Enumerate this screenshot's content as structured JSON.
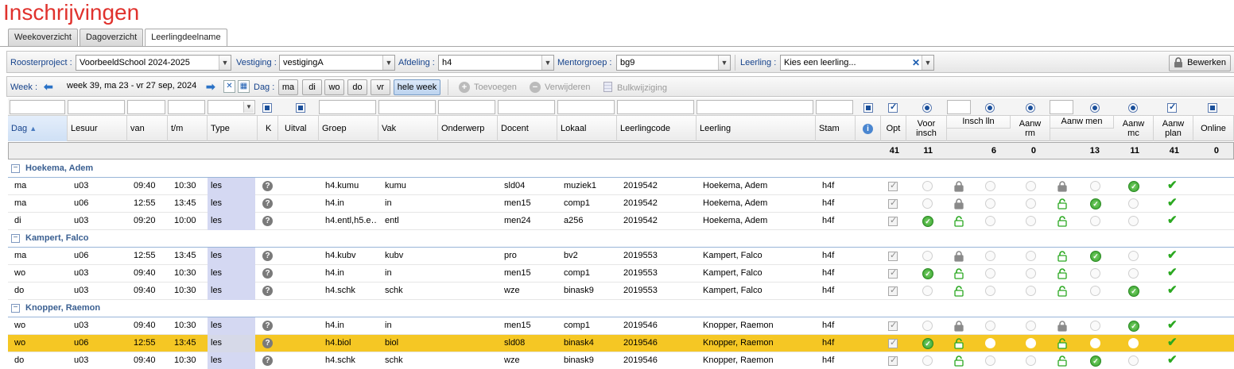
{
  "title": "Inschrijvingen",
  "tabs": [
    "Weekoverzicht",
    "Dagoverzicht",
    "Leerlingdeelname"
  ],
  "filters": {
    "roosterproject_label": "Roosterproject :",
    "roosterproject_value": "VoorbeeldSchool 2024-2025",
    "vestiging_label": "Vestiging :",
    "vestiging_value": "vestigingA",
    "afdeling_label": "Afdeling :",
    "afdeling_value": "h4",
    "mentorgroep_label": "Mentorgroep :",
    "mentorgroep_value": "bg9",
    "leerling_label": "Leerling :",
    "leerling_placeholder": "Kies een leerling...",
    "edit_button": "Bewerken"
  },
  "weekbar": {
    "week_label": "Week :",
    "week_value": "week 39, ma 23 - vr 27 sep, 2024",
    "dag_label": "Dag :",
    "days": [
      "ma",
      "di",
      "wo",
      "do",
      "vr"
    ],
    "all_week": "hele week",
    "toevoegen": "Toevoegen",
    "verwijderen": "Verwijderen",
    "bulkwijziging": "Bulkwijziging"
  },
  "columns": {
    "dag": "Dag",
    "lesuur": "Lesuur",
    "van": "van",
    "tm": "t/m",
    "type": "Type",
    "k": "K",
    "uitval": "Uitval",
    "groep": "Groep",
    "vak": "Vak",
    "onderwerp": "Onderwerp",
    "docent": "Docent",
    "lokaal": "Lokaal",
    "leerlingcode": "Leerlingcode",
    "leerling": "Leerling",
    "stam": "Stam",
    "opt": "Opt",
    "voor_insch_1": "Voor",
    "voor_insch_2": "insch",
    "insch_lln": "Insch lln",
    "aanw_rm_1": "Aanw",
    "aanw_rm_2": "rm",
    "aanw_men": "Aanw men",
    "aanw_mc_1": "Aanw",
    "aanw_mc_2": "mc",
    "aanw_plan_1": "Aanw",
    "aanw_plan_2": "plan",
    "online": "Online"
  },
  "totals": {
    "opt": "41",
    "voor_insch": "11",
    "insch_lln": "6",
    "aanw_rm": "0",
    "aanw_men": "13",
    "aanw_mc": "11",
    "aanw_plan": "41",
    "online": "0"
  },
  "groups": [
    {
      "name": "Hoekema, Adem",
      "rows": [
        {
          "dag": "ma",
          "lesuur": "u03",
          "van": "09:40",
          "tm": "10:30",
          "type": "les",
          "groep": "h4.kumu",
          "vak": "kumu",
          "docent": "sld04",
          "lokaal": "muziek1",
          "code": "2019542",
          "leerling": "Hoekema, Adem",
          "stam": "h4f"
        },
        {
          "dag": "ma",
          "lesuur": "u06",
          "van": "12:55",
          "tm": "13:45",
          "type": "les",
          "groep": "h4.in",
          "vak": "in",
          "docent": "men15",
          "lokaal": "comp1",
          "code": "2019542",
          "leerling": "Hoekema, Adem",
          "stam": "h4f"
        },
        {
          "dag": "di",
          "lesuur": "u03",
          "van": "09:20",
          "tm": "10:00",
          "type": "les",
          "groep": "h4.entl,h5.e…",
          "vak": "entl",
          "docent": "men24",
          "lokaal": "a256",
          "code": "2019542",
          "leerling": "Hoekema, Adem",
          "stam": "h4f"
        }
      ]
    },
    {
      "name": "Kampert, Falco",
      "rows": [
        {
          "dag": "ma",
          "lesuur": "u06",
          "van": "12:55",
          "tm": "13:45",
          "type": "les",
          "groep": "h4.kubv",
          "vak": "kubv",
          "docent": "pro",
          "lokaal": "bv2",
          "code": "2019553",
          "leerling": "Kampert, Falco",
          "stam": "h4f"
        },
        {
          "dag": "wo",
          "lesuur": "u03",
          "van": "09:40",
          "tm": "10:30",
          "type": "les",
          "groep": "h4.in",
          "vak": "in",
          "docent": "men15",
          "lokaal": "comp1",
          "code": "2019553",
          "leerling": "Kampert, Falco",
          "stam": "h4f"
        },
        {
          "dag": "do",
          "lesuur": "u03",
          "van": "09:40",
          "tm": "10:30",
          "type": "les",
          "groep": "h4.schk",
          "vak": "schk",
          "docent": "wze",
          "lokaal": "binask9",
          "code": "2019553",
          "leerling": "Kampert, Falco",
          "stam": "h4f"
        }
      ]
    },
    {
      "name": "Knopper, Raemon",
      "rows": [
        {
          "dag": "wo",
          "lesuur": "u03",
          "van": "09:40",
          "tm": "10:30",
          "type": "les",
          "groep": "h4.in",
          "vak": "in",
          "docent": "men15",
          "lokaal": "comp1",
          "code": "2019546",
          "leerling": "Knopper, Raemon",
          "stam": "h4f"
        },
        {
          "dag": "wo",
          "lesuur": "u06",
          "van": "12:55",
          "tm": "13:45",
          "type": "les",
          "groep": "h4.biol",
          "vak": "biol",
          "docent": "sld08",
          "lokaal": "binask4",
          "code": "2019546",
          "leerling": "Knopper, Raemon",
          "stam": "h4f"
        },
        {
          "dag": "do",
          "lesuur": "u03",
          "van": "09:40",
          "tm": "10:30",
          "type": "les",
          "groep": "h4.schk",
          "vak": "schk",
          "docent": "wze",
          "lokaal": "binask9",
          "code": "2019546",
          "leerling": "Knopper, Raemon",
          "stam": "h4f"
        }
      ]
    }
  ],
  "colors": {
    "title_red": "#e0322d",
    "selected_row": "#f5c724",
    "type_cell": "#d4d8f2",
    "group_text": "#3a5f91",
    "label_blue": "#15428b"
  }
}
